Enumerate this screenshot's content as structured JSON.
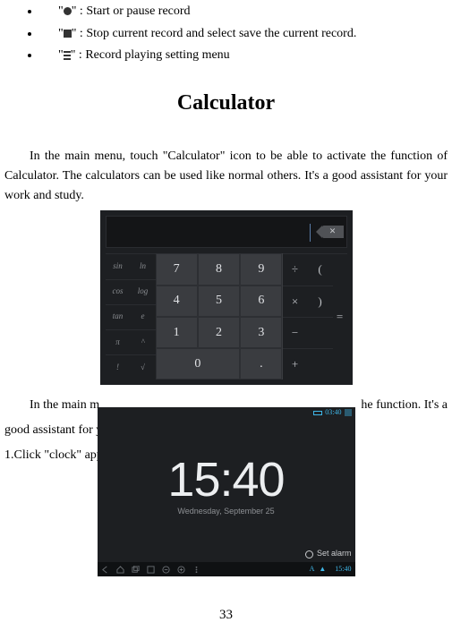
{
  "record_bullets": {
    "start_pause": "\" : Start or pause record",
    "stop_save": "\" : Stop current record and select save the current record.",
    "settings": "\" : Record playing setting menu"
  },
  "calculator": {
    "heading": "Calculator",
    "intro": "In the main menu, touch \"Calculator\" icon to be able to activate the function of Calculator. The calculators can be used like normal others. It's a good assistant for your work and study.",
    "keys": {
      "fn": [
        "sin",
        "ln",
        "cos",
        "log",
        "tan",
        "e",
        "π",
        "^",
        "!",
        "√"
      ],
      "num": [
        "7",
        "8",
        "9",
        "4",
        "5",
        "6",
        "1",
        "2",
        "3",
        "0",
        "."
      ],
      "ops": [
        "÷",
        "×",
        "−",
        "+"
      ],
      "paren": [
        "(",
        ")",
        "",
        ""
      ],
      "eq": "="
    }
  },
  "clock": {
    "fragment1_1": "In the main m",
    "fragment1_2": "he function. It's a",
    "fragment2": "good assistant for y",
    "fragment3": "1.Click \"clock\" app",
    "time": "15:40",
    "date": "Wednesday, September 25",
    "set_alarm": "Set alarm",
    "status_time": "03:40"
  },
  "page_number": "33"
}
